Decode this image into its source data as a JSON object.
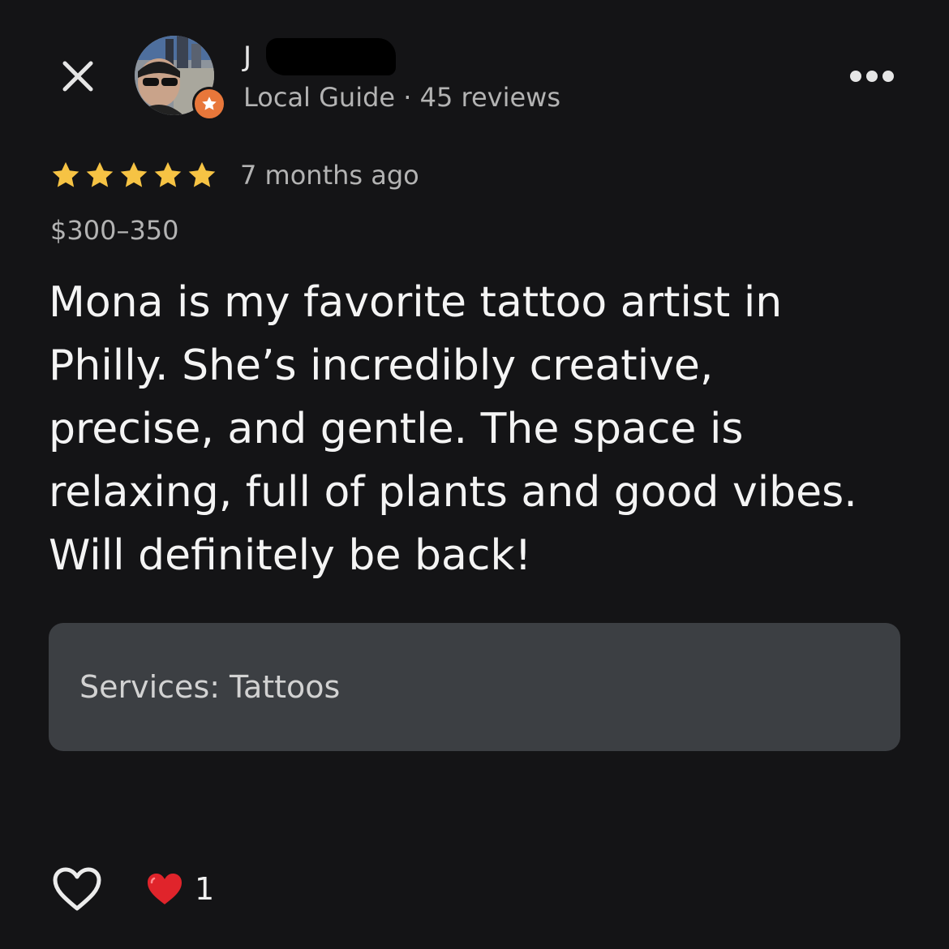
{
  "header": {
    "close_icon": "close-icon",
    "more_icon": "more-horizontal-icon"
  },
  "author": {
    "name": "J",
    "meta": "Local Guide · 45 reviews",
    "badge_icon": "local-guide-star-icon"
  },
  "review": {
    "rating": 5,
    "rating_max": 5,
    "timestamp": "7 months ago",
    "price": "$300–350",
    "text": "Mona is my favorite tattoo artist in\nPhilly. She’s incredibly creative,\nprecise, and gentle. The space is\nrelaxing, full of plants and good vibes.\nWill definitely be back!"
  },
  "services": {
    "label": "Services:",
    "value": "Tattoos"
  },
  "footer": {
    "like_icon": "heart-outline-icon",
    "reaction_icon": "red-heart-icon",
    "reaction_count": "1"
  },
  "colors": {
    "background": "#141416",
    "star": "#f6c344",
    "badge": "#e8773a",
    "card": "#3c3f43",
    "heart": "#e0242b"
  }
}
